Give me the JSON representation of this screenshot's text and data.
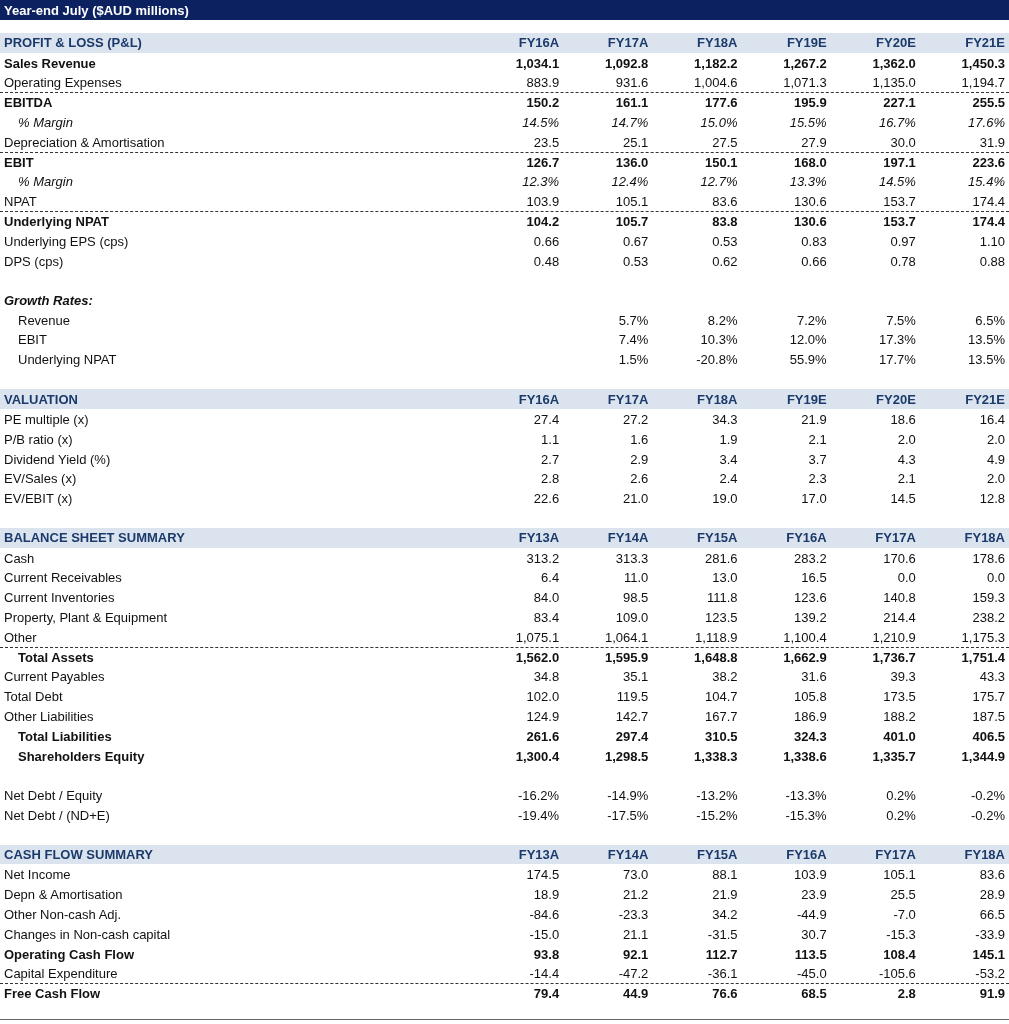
{
  "title": "Year-end July ($AUD millions)",
  "rows": [
    {
      "kind": "header",
      "label": "PROFIT & LOSS (P&L)",
      "columns": [
        "FY16A",
        "FY17A",
        "FY18A",
        "FY19E",
        "FY20E",
        "FY21E"
      ]
    },
    {
      "kind": "line",
      "label": "Sales Revenue",
      "bold": true,
      "italic": false,
      "indent": false,
      "rule_above": false,
      "values": [
        "1,034.1",
        "1,092.8",
        "1,182.2",
        "1,267.2",
        "1,362.0",
        "1,450.3"
      ]
    },
    {
      "kind": "line",
      "label": "Operating Expenses",
      "bold": false,
      "italic": false,
      "indent": false,
      "rule_above": false,
      "values": [
        "883.9",
        "931.6",
        "1,004.6",
        "1,071.3",
        "1,135.0",
        "1,194.7"
      ]
    },
    {
      "kind": "line",
      "label": "EBITDA",
      "bold": true,
      "italic": false,
      "indent": false,
      "rule_above": true,
      "values": [
        "150.2",
        "161.1",
        "177.6",
        "195.9",
        "227.1",
        "255.5"
      ]
    },
    {
      "kind": "line",
      "label": "% Margin",
      "bold": false,
      "italic": true,
      "indent": true,
      "rule_above": false,
      "values": [
        "14.5%",
        "14.7%",
        "15.0%",
        "15.5%",
        "16.7%",
        "17.6%"
      ]
    },
    {
      "kind": "line",
      "label": "Depreciation & Amortisation",
      "bold": false,
      "italic": false,
      "indent": false,
      "rule_above": false,
      "values": [
        "23.5",
        "25.1",
        "27.5",
        "27.9",
        "30.0",
        "31.9"
      ]
    },
    {
      "kind": "line",
      "label": "EBIT",
      "bold": true,
      "italic": false,
      "indent": false,
      "rule_above": true,
      "values": [
        "126.7",
        "136.0",
        "150.1",
        "168.0",
        "197.1",
        "223.6"
      ]
    },
    {
      "kind": "line",
      "label": "% Margin",
      "bold": false,
      "italic": true,
      "indent": true,
      "rule_above": false,
      "values": [
        "12.3%",
        "12.4%",
        "12.7%",
        "13.3%",
        "14.5%",
        "15.4%"
      ]
    },
    {
      "kind": "line",
      "label": "NPAT",
      "bold": false,
      "italic": false,
      "indent": false,
      "rule_above": false,
      "values": [
        "103.9",
        "105.1",
        "83.6",
        "130.6",
        "153.7",
        "174.4"
      ]
    },
    {
      "kind": "line",
      "label": "Underlying NPAT",
      "bold": true,
      "italic": false,
      "indent": false,
      "rule_above": true,
      "values": [
        "104.2",
        "105.7",
        "83.8",
        "130.6",
        "153.7",
        "174.4"
      ]
    },
    {
      "kind": "line",
      "label": "Underlying EPS (cps)",
      "bold": false,
      "italic": false,
      "indent": false,
      "rule_above": false,
      "values": [
        "0.66",
        "0.67",
        "0.53",
        "0.83",
        "0.97",
        "1.10"
      ]
    },
    {
      "kind": "line",
      "label": "DPS (cps)",
      "bold": false,
      "italic": false,
      "indent": false,
      "rule_above": false,
      "values": [
        "0.48",
        "0.53",
        "0.62",
        "0.66",
        "0.78",
        "0.88"
      ]
    },
    {
      "kind": "spacer"
    },
    {
      "kind": "subheading",
      "label": "Growth Rates:"
    },
    {
      "kind": "growth_line",
      "label": "Revenue",
      "values": [
        "5.7%",
        "8.2%",
        "7.2%",
        "7.5%",
        "6.5%"
      ]
    },
    {
      "kind": "growth_line",
      "label": "EBIT",
      "values": [
        "7.4%",
        "10.3%",
        "12.0%",
        "17.3%",
        "13.5%"
      ]
    },
    {
      "kind": "growth_line",
      "label": "Underlying NPAT",
      "values": [
        "1.5%",
        "-20.8%",
        "55.9%",
        "17.7%",
        "13.5%"
      ]
    },
    {
      "kind": "spacer"
    },
    {
      "kind": "header",
      "label": "VALUATION",
      "columns": [
        "FY16A",
        "FY17A",
        "FY18A",
        "FY19E",
        "FY20E",
        "FY21E"
      ]
    },
    {
      "kind": "line",
      "label": "PE multiple (x)",
      "bold": false,
      "italic": false,
      "indent": false,
      "rule_above": false,
      "values": [
        "27.4",
        "27.2",
        "34.3",
        "21.9",
        "18.6",
        "16.4"
      ]
    },
    {
      "kind": "line",
      "label": "P/B ratio (x)",
      "bold": false,
      "italic": false,
      "indent": false,
      "rule_above": false,
      "values": [
        "1.1",
        "1.6",
        "1.9",
        "2.1",
        "2.0",
        "2.0"
      ]
    },
    {
      "kind": "line",
      "label": "Dividend Yield (%)",
      "bold": false,
      "italic": false,
      "indent": false,
      "rule_above": false,
      "values": [
        "2.7",
        "2.9",
        "3.4",
        "3.7",
        "4.3",
        "4.9"
      ]
    },
    {
      "kind": "line",
      "label": "EV/Sales (x)",
      "bold": false,
      "italic": false,
      "indent": false,
      "rule_above": false,
      "values": [
        "2.8",
        "2.6",
        "2.4",
        "2.3",
        "2.1",
        "2.0"
      ]
    },
    {
      "kind": "line",
      "label": "EV/EBIT (x)",
      "bold": false,
      "italic": false,
      "indent": false,
      "rule_above": false,
      "values": [
        "22.6",
        "21.0",
        "19.0",
        "17.0",
        "14.5",
        "12.8"
      ]
    },
    {
      "kind": "spacer"
    },
    {
      "kind": "header",
      "label": "BALANCE SHEET SUMMARY",
      "columns": [
        "FY13A",
        "FY14A",
        "FY15A",
        "FY16A",
        "FY17A",
        "FY18A"
      ]
    },
    {
      "kind": "line",
      "label": "Cash",
      "bold": false,
      "italic": false,
      "indent": false,
      "rule_above": false,
      "values": [
        "313.2",
        "313.3",
        "281.6",
        "283.2",
        "170.6",
        "178.6"
      ]
    },
    {
      "kind": "line",
      "label": "Current Receivables",
      "bold": false,
      "italic": false,
      "indent": false,
      "rule_above": false,
      "values": [
        "6.4",
        "11.0",
        "13.0",
        "16.5",
        "0.0",
        "0.0"
      ]
    },
    {
      "kind": "line",
      "label": "Current Inventories",
      "bold": false,
      "italic": false,
      "indent": false,
      "rule_above": false,
      "values": [
        "84.0",
        "98.5",
        "111.8",
        "123.6",
        "140.8",
        "159.3"
      ]
    },
    {
      "kind": "line",
      "label": "Property, Plant & Equipment",
      "bold": false,
      "italic": false,
      "indent": false,
      "rule_above": false,
      "values": [
        "83.4",
        "109.0",
        "123.5",
        "139.2",
        "214.4",
        "238.2"
      ]
    },
    {
      "kind": "line",
      "label": "Other",
      "bold": false,
      "italic": false,
      "indent": false,
      "rule_above": false,
      "values": [
        "1,075.1",
        "1,064.1",
        "1,118.9",
        "1,100.4",
        "1,210.9",
        "1,175.3"
      ]
    },
    {
      "kind": "line",
      "label": "Total Assets",
      "bold": true,
      "italic": false,
      "indent": true,
      "rule_above": true,
      "values": [
        "1,562.0",
        "1,595.9",
        "1,648.8",
        "1,662.9",
        "1,736.7",
        "1,751.4"
      ]
    },
    {
      "kind": "line",
      "label": "Current Payables",
      "bold": false,
      "italic": false,
      "indent": false,
      "rule_above": false,
      "values": [
        "34.8",
        "35.1",
        "38.2",
        "31.6",
        "39.3",
        "43.3"
      ]
    },
    {
      "kind": "line",
      "label": "Total Debt",
      "bold": false,
      "italic": false,
      "indent": false,
      "rule_above": false,
      "values": [
        "102.0",
        "119.5",
        "104.7",
        "105.8",
        "173.5",
        "175.7"
      ]
    },
    {
      "kind": "line",
      "label": "Other Liabilities",
      "bold": false,
      "italic": false,
      "indent": false,
      "rule_above": false,
      "values": [
        "124.9",
        "142.7",
        "167.7",
        "186.9",
        "188.2",
        "187.5"
      ]
    },
    {
      "kind": "line",
      "label": "Total Liabilities",
      "bold": true,
      "italic": false,
      "indent": true,
      "rule_above": false,
      "values": [
        "261.6",
        "297.4",
        "310.5",
        "324.3",
        "401.0",
        "406.5"
      ]
    },
    {
      "kind": "line",
      "label": "Shareholders Equity",
      "bold": true,
      "italic": false,
      "indent": true,
      "rule_above": false,
      "values": [
        "1,300.4",
        "1,298.5",
        "1,338.3",
        "1,338.6",
        "1,335.7",
        "1,344.9"
      ]
    },
    {
      "kind": "spacer"
    },
    {
      "kind": "line",
      "label": "Net Debt / Equity",
      "bold": false,
      "italic": false,
      "indent": false,
      "rule_above": false,
      "values": [
        "-16.2%",
        "-14.9%",
        "-13.2%",
        "-13.3%",
        "0.2%",
        "-0.2%"
      ]
    },
    {
      "kind": "line",
      "label": "Net Debt / (ND+E)",
      "bold": false,
      "italic": false,
      "indent": false,
      "rule_above": false,
      "values": [
        "-19.4%",
        "-17.5%",
        "-15.2%",
        "-15.3%",
        "0.2%",
        "-0.2%"
      ]
    },
    {
      "kind": "spacer"
    },
    {
      "kind": "header",
      "label": "CASH FLOW SUMMARY",
      "columns": [
        "FY13A",
        "FY14A",
        "FY15A",
        "FY16A",
        "FY17A",
        "FY18A"
      ]
    },
    {
      "kind": "line",
      "label": "Net Income",
      "bold": false,
      "italic": false,
      "indent": false,
      "rule_above": false,
      "values": [
        "174.5",
        "73.0",
        "88.1",
        "103.9",
        "105.1",
        "83.6"
      ]
    },
    {
      "kind": "line",
      "label": "Depn & Amortisation",
      "bold": false,
      "italic": false,
      "indent": false,
      "rule_above": false,
      "values": [
        "18.9",
        "21.2",
        "21.9",
        "23.9",
        "25.5",
        "28.9"
      ]
    },
    {
      "kind": "line",
      "label": "Other Non-cash Adj.",
      "bold": false,
      "italic": false,
      "indent": false,
      "rule_above": false,
      "values": [
        "-84.6",
        "-23.3",
        "34.2",
        "-44.9",
        "-7.0",
        "66.5"
      ]
    },
    {
      "kind": "line",
      "label": "Changes in Non-cash capital",
      "bold": false,
      "italic": false,
      "indent": false,
      "rule_above": false,
      "values": [
        "-15.0",
        "21.1",
        "-31.5",
        "30.7",
        "-15.3",
        "-33.9"
      ]
    },
    {
      "kind": "line",
      "label": "Operating Cash Flow",
      "bold": true,
      "italic": false,
      "indent": false,
      "rule_above": false,
      "values": [
        "93.8",
        "92.1",
        "112.7",
        "113.5",
        "108.4",
        "145.1"
      ]
    },
    {
      "kind": "line",
      "label": "Capital Expenditure",
      "bold": false,
      "italic": false,
      "indent": false,
      "rule_above": false,
      "values": [
        "-14.4",
        "-47.2",
        "-36.1",
        "-45.0",
        "-105.6",
        "-53.2"
      ]
    },
    {
      "kind": "line",
      "label": "Free Cash Flow",
      "bold": true,
      "italic": false,
      "indent": false,
      "rule_above": true,
      "values": [
        "79.4",
        "44.9",
        "76.6",
        "68.5",
        "2.8",
        "91.9"
      ]
    }
  ]
}
